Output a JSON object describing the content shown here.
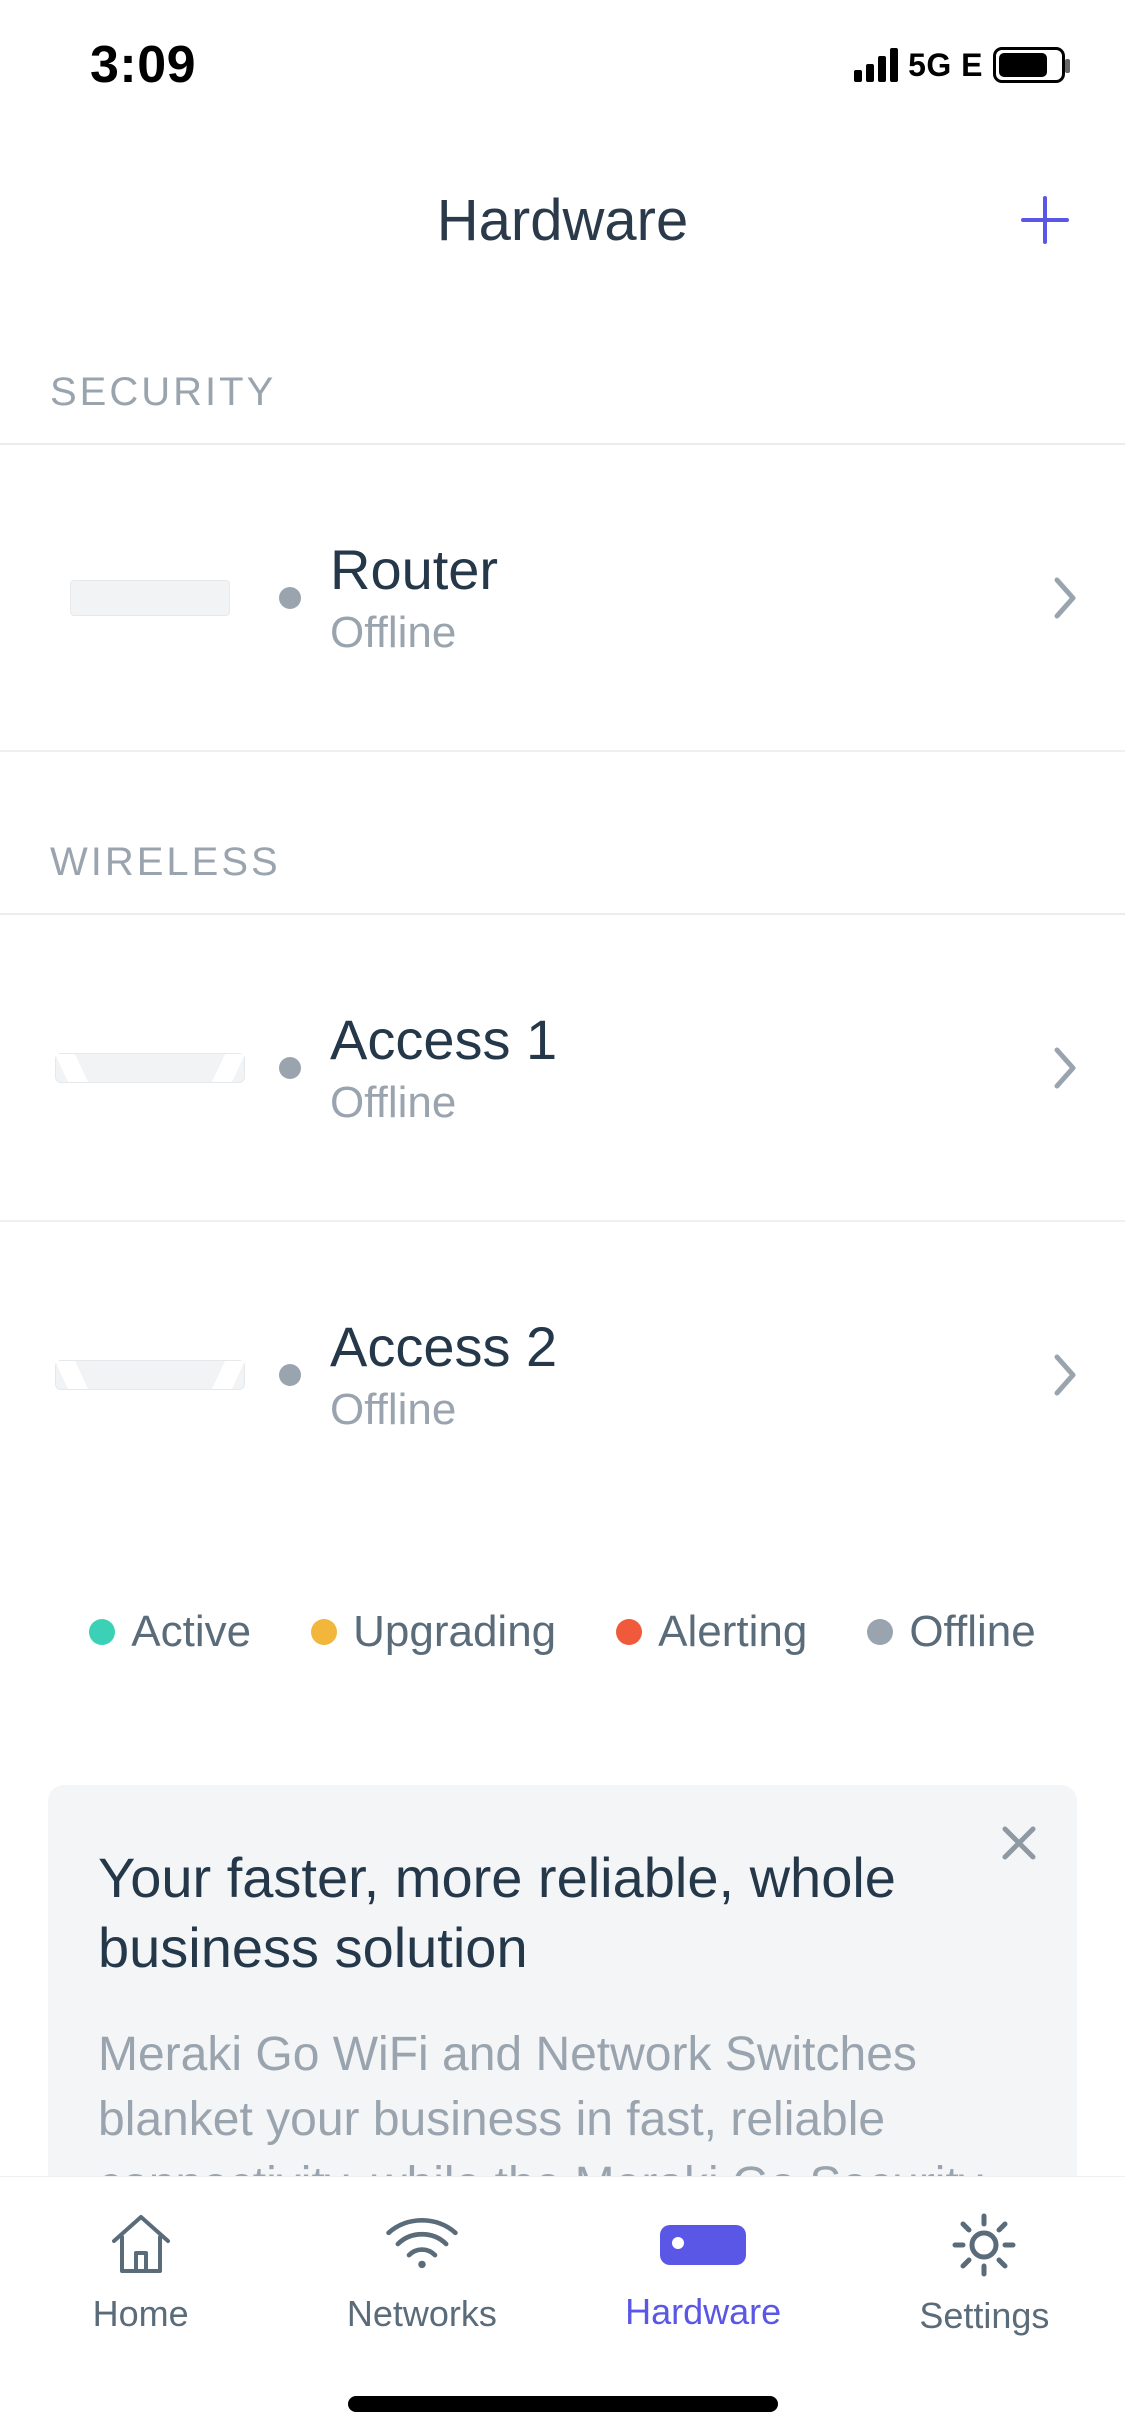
{
  "status_bar": {
    "time": "3:09",
    "network_label": "5G E"
  },
  "header": {
    "title": "Hardware"
  },
  "sections": {
    "security": {
      "header": "SECURITY"
    },
    "wireless": {
      "header": "WIRELESS"
    }
  },
  "devices": {
    "router": {
      "name": "Router",
      "status": "Offline"
    },
    "access1": {
      "name": "Access 1",
      "status": "Offline"
    },
    "access2": {
      "name": "Access 2",
      "status": "Offline"
    }
  },
  "legend": {
    "active": {
      "label": "Active",
      "color": "#3ad1b6"
    },
    "upgrading": {
      "label": "Upgrading",
      "color": "#f2b63a"
    },
    "alerting": {
      "label": "Alerting",
      "color": "#f05a3a"
    },
    "offline": {
      "label": "Offline",
      "color": "#9aa4ae"
    }
  },
  "promo": {
    "title": "Your faster, more reliable, whole business solution",
    "body": "Meraki Go WiFi and Network Switches blanket your business in fast, reliable connectivity, while the Meraki Go Security Gateway provides protection and peace of"
  },
  "tabs": {
    "home": "Home",
    "networks": "Networks",
    "hardware": "Hardware",
    "settings": "Settings"
  }
}
